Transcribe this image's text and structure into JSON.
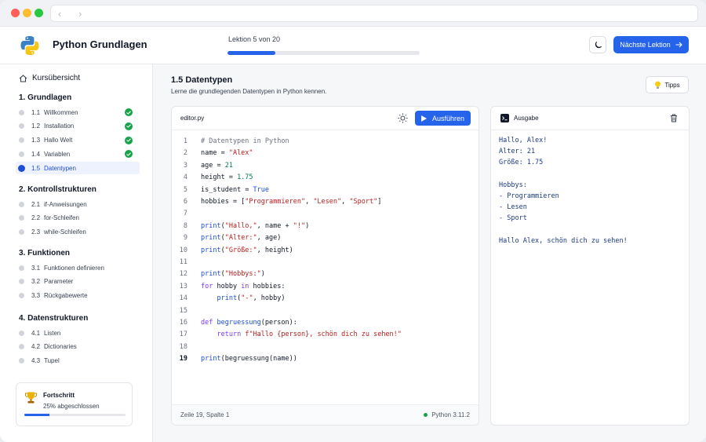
{
  "app": {
    "title": "Python Grundlagen"
  },
  "header": {
    "progress_text": "Lektion 5 von 20",
    "progress_fraction": 0.25,
    "next_button": "Nächste Lektion"
  },
  "sidebar": {
    "overview": "Kursübersicht",
    "sections": [
      {
        "title": "1. Grundlagen",
        "items": [
          {
            "num": "1.1",
            "label": "Willkommen",
            "done": true
          },
          {
            "num": "1.2",
            "label": "Installation",
            "done": true
          },
          {
            "num": "1.3",
            "label": "Hallo Welt",
            "done": true
          },
          {
            "num": "1.4",
            "label": "Variablen",
            "done": true
          },
          {
            "num": "1.5",
            "label": "Datentypen",
            "done": false,
            "active": true
          }
        ]
      },
      {
        "title": "2. Kontrollstrukturen",
        "items": [
          {
            "num": "2.1",
            "label": "if-Anweisungen"
          },
          {
            "num": "2.2",
            "label": "for-Schleifen"
          },
          {
            "num": "2.3",
            "label": "while-Schleifen"
          }
        ]
      },
      {
        "title": "3. Funktionen",
        "items": [
          {
            "num": "3.1",
            "label": "Funktionen definieren"
          },
          {
            "num": "3.2",
            "label": "Parameter"
          },
          {
            "num": "3.3",
            "label": "Rückgabewerte"
          }
        ]
      },
      {
        "title": "4. Datenstrukturen",
        "items": [
          {
            "num": "4.1",
            "label": "Listen"
          },
          {
            "num": "4.2",
            "label": "Dictionaries"
          },
          {
            "num": "4.3",
            "label": "Tupel"
          }
        ]
      }
    ],
    "progress_card": {
      "title": "Fortschritt",
      "subtitle": "25% abgeschlossen",
      "fraction": 0.25
    }
  },
  "lesson": {
    "title": "1.5 Datentypen",
    "subtitle": "Lerne die grundlegenden Datentypen in Python kennen.",
    "tips_button": "Tipps"
  },
  "editor": {
    "filename": "editor.py",
    "run_button": "Ausführen",
    "current_line": 19,
    "lines": [
      [
        [
          "c-cm",
          "# Datentypen in Python"
        ]
      ],
      [
        [
          "",
          "name = "
        ],
        [
          "c-st",
          "\"Alex\""
        ]
      ],
      [
        [
          "",
          "age = "
        ],
        [
          "c-nm",
          "21"
        ]
      ],
      [
        [
          "",
          "height = "
        ],
        [
          "c-nm",
          "1.75"
        ]
      ],
      [
        [
          "",
          "is_student = "
        ],
        [
          "c-fn",
          "True"
        ]
      ],
      [
        [
          "",
          "hobbies = ["
        ],
        [
          "c-st",
          "\"Programmieren\""
        ],
        [
          "",
          ", "
        ],
        [
          "c-st",
          "\"Lesen\""
        ],
        [
          "",
          ", "
        ],
        [
          "c-st",
          "\"Sport\""
        ],
        [
          "",
          "]"
        ]
      ],
      [],
      [
        [
          "c-fn",
          "print"
        ],
        [
          "",
          "("
        ],
        [
          "c-st",
          "\"Hallo,\""
        ],
        [
          "",
          ", name + "
        ],
        [
          "c-st",
          "\"!\""
        ],
        [
          "",
          ")"
        ]
      ],
      [
        [
          "c-fn",
          "print"
        ],
        [
          "",
          "("
        ],
        [
          "c-st",
          "\"Alter:\""
        ],
        [
          "",
          ", age)"
        ]
      ],
      [
        [
          "c-fn",
          "print"
        ],
        [
          "",
          "("
        ],
        [
          "c-st",
          "\"Größe:\""
        ],
        [
          "",
          ", height)"
        ]
      ],
      [],
      [
        [
          "c-fn",
          "print"
        ],
        [
          "",
          "("
        ],
        [
          "c-st",
          "\"Hobbys:\""
        ],
        [
          "",
          ")"
        ]
      ],
      [
        [
          "c-kw",
          "for"
        ],
        [
          "",
          " hobby "
        ],
        [
          "c-kw",
          "in"
        ],
        [
          "",
          " hobbies:"
        ]
      ],
      [
        [
          "",
          "    "
        ],
        [
          "c-fn",
          "print"
        ],
        [
          "",
          "("
        ],
        [
          "c-st",
          "\"-\""
        ],
        [
          "",
          ", hobby)"
        ]
      ],
      [],
      [
        [
          "c-kw",
          "def"
        ],
        [
          "",
          " "
        ],
        [
          "c-fn",
          "begruessung"
        ],
        [
          "",
          "(person):"
        ]
      ],
      [
        [
          "",
          "    "
        ],
        [
          "c-kw",
          "return"
        ],
        [
          "",
          " "
        ],
        [
          "c-st",
          "f\"Hallo {person}, schön dich zu sehen!\""
        ]
      ],
      [],
      [
        [
          "c-fn",
          "print"
        ],
        [
          "",
          "(begruessung(name))"
        ]
      ]
    ],
    "status_position": "Zeile 19, Spalte 1",
    "status_version": "Python 3.11.2"
  },
  "output": {
    "title": "Ausgabe",
    "lines": [
      "Hallo, Alex!",
      "Alter: 21",
      "Größe: 1.75",
      "",
      "Hobbys:",
      "- Programmieren",
      "- Lesen",
      "- Sport",
      "",
      "Hallo Alex, schön dich zu sehen!"
    ]
  },
  "colors": {
    "accent": "#2563eb",
    "success": "#16a34a"
  }
}
